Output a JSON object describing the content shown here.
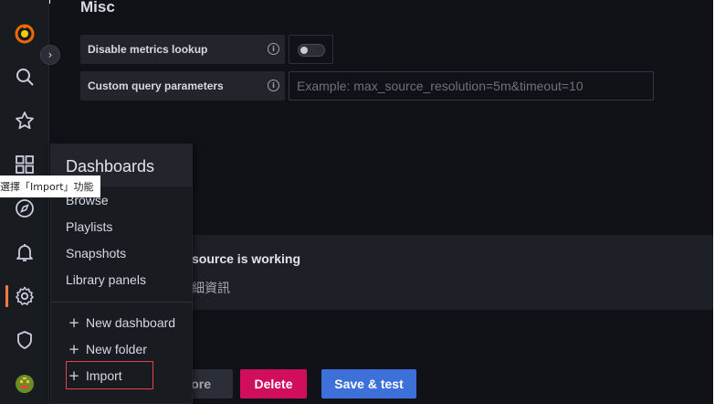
{
  "section": {
    "title": "Misc"
  },
  "settings": {
    "metrics_lookup_label": "Disable metrics lookup",
    "custom_query_label": "Custom query parameters",
    "custom_query_placeholder": "Example: max_source_resolution=5m&timeout=10",
    "custom_query_value": ""
  },
  "alert": {
    "title_partial": "source is working",
    "subtitle_partial": "細資訊"
  },
  "buttons": {
    "explore_partial": "ore",
    "delete": "Delete",
    "save_test": "Save & test"
  },
  "menu": {
    "title": "Dashboards",
    "items": [
      {
        "label": "Browse"
      },
      {
        "label": "Playlists"
      },
      {
        "label": "Snapshots"
      },
      {
        "label": "Library panels"
      }
    ],
    "actions": [
      {
        "label": "New dashboard"
      },
      {
        "label": "New folder"
      },
      {
        "label": "Import"
      }
    ]
  },
  "tooltip": {
    "text": "選擇「Import」功能"
  },
  "colors": {
    "accent": "#ff7941",
    "delete": "#d10e5c",
    "primary": "#3d71d9",
    "highlight": "#e8414a"
  },
  "icons": {
    "sidebar": [
      "grafana-logo-icon",
      "search-icon",
      "star-icon",
      "dashboards-grid-icon",
      "compass-icon",
      "bell-icon",
      "gear-icon",
      "shield-icon",
      "user-avatar-icon"
    ]
  }
}
